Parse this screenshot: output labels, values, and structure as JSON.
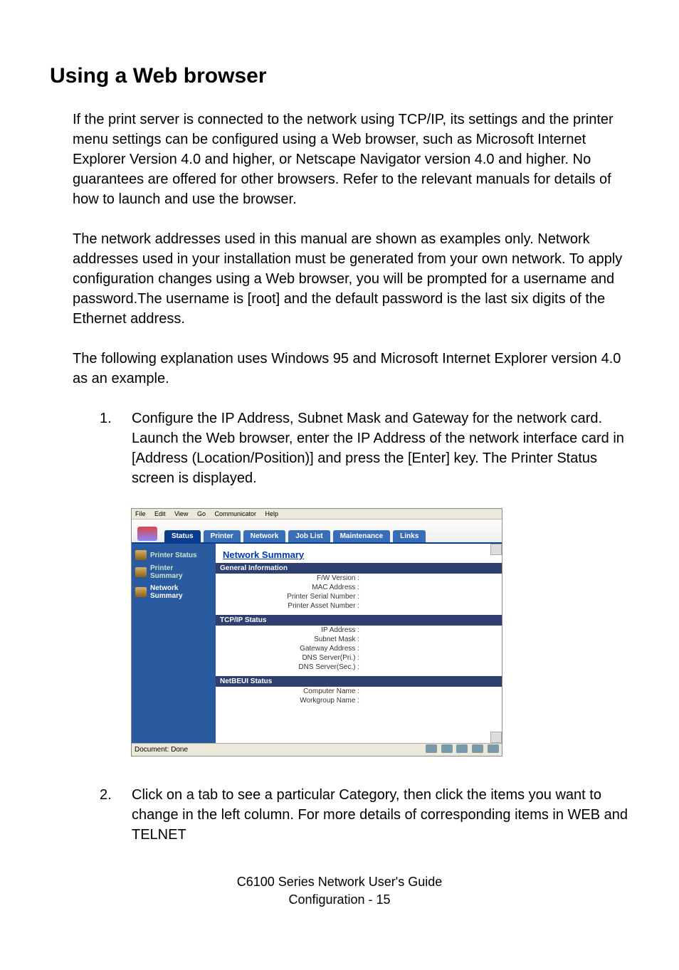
{
  "title": "Using a Web browser",
  "para1": "If the print server is connected to the network using TCP/IP, its settings and the printer menu settings can be configured using a Web browser, such as Microsoft Internet Explorer Version 4.0 and higher, or Netscape Navigator version 4.0 and higher. No guarantees are offered for other browsers. Refer to the relevant manuals for details of how to launch and use the browser.",
  "para2": "The network addresses used in this manual are shown as examples only. Network addresses used in your installation must be generated from your own network. To apply configuration changes using a Web browser, you will be prompted for a username and password.The username is [root] and the default password is the last six digits of the Ethernet address.",
  "para3": "The following explanation uses Windows 95 and Microsoft Internet Explorer version 4.0 as an example.",
  "steps": {
    "s1num": "1.",
    "s1": "Configure the IP Address, Subnet Mask and Gateway for the network card. Launch the Web browser, enter the IP Address of the network interface card in [Address (Location/Position)] and press the [Enter] key. The Printer Status screen is displayed.",
    "s2num": "2.",
    "s2": "Click on a tab to see a particular Category, then click the items you want to change in the left column. For more details of corresponding items in WEB and TELNET"
  },
  "browser": {
    "menu": {
      "file": "File",
      "edit": "Edit",
      "view": "View",
      "go": "Go",
      "communicator": "Communicator",
      "help": "Help"
    },
    "tabs": {
      "status": "Status",
      "printer": "Printer",
      "network": "Network",
      "joblist": "Job List",
      "maintenance": "Maintenance",
      "links": "Links"
    },
    "sidebar": {
      "i1": "Printer Status",
      "i2a": "Printer",
      "i2b": "Summary",
      "i3a": "Network",
      "i3b": "Summary"
    },
    "heading": "Network Summary",
    "sections": {
      "genInfo": "General Information",
      "gi1": "F/W Version :",
      "gi2": "MAC Address :",
      "gi3": "Printer Serial Number :",
      "gi4": "Printer Asset Number :",
      "tcpip": "TCP/IP Status",
      "t1": "IP Address :",
      "t2": "Subnet Mask :",
      "t3": "Gateway Address :",
      "t4": "DNS Server(Pri.) :",
      "t5": "DNS Server(Sec.) :",
      "netbeui": "NetBEUI Status",
      "n1": "Computer Name :",
      "n2": "Workgroup Name :"
    },
    "statusbar": "Document: Done"
  },
  "footer1": "C6100 Series Network User's Guide",
  "footer2": "Configuration   -   15"
}
